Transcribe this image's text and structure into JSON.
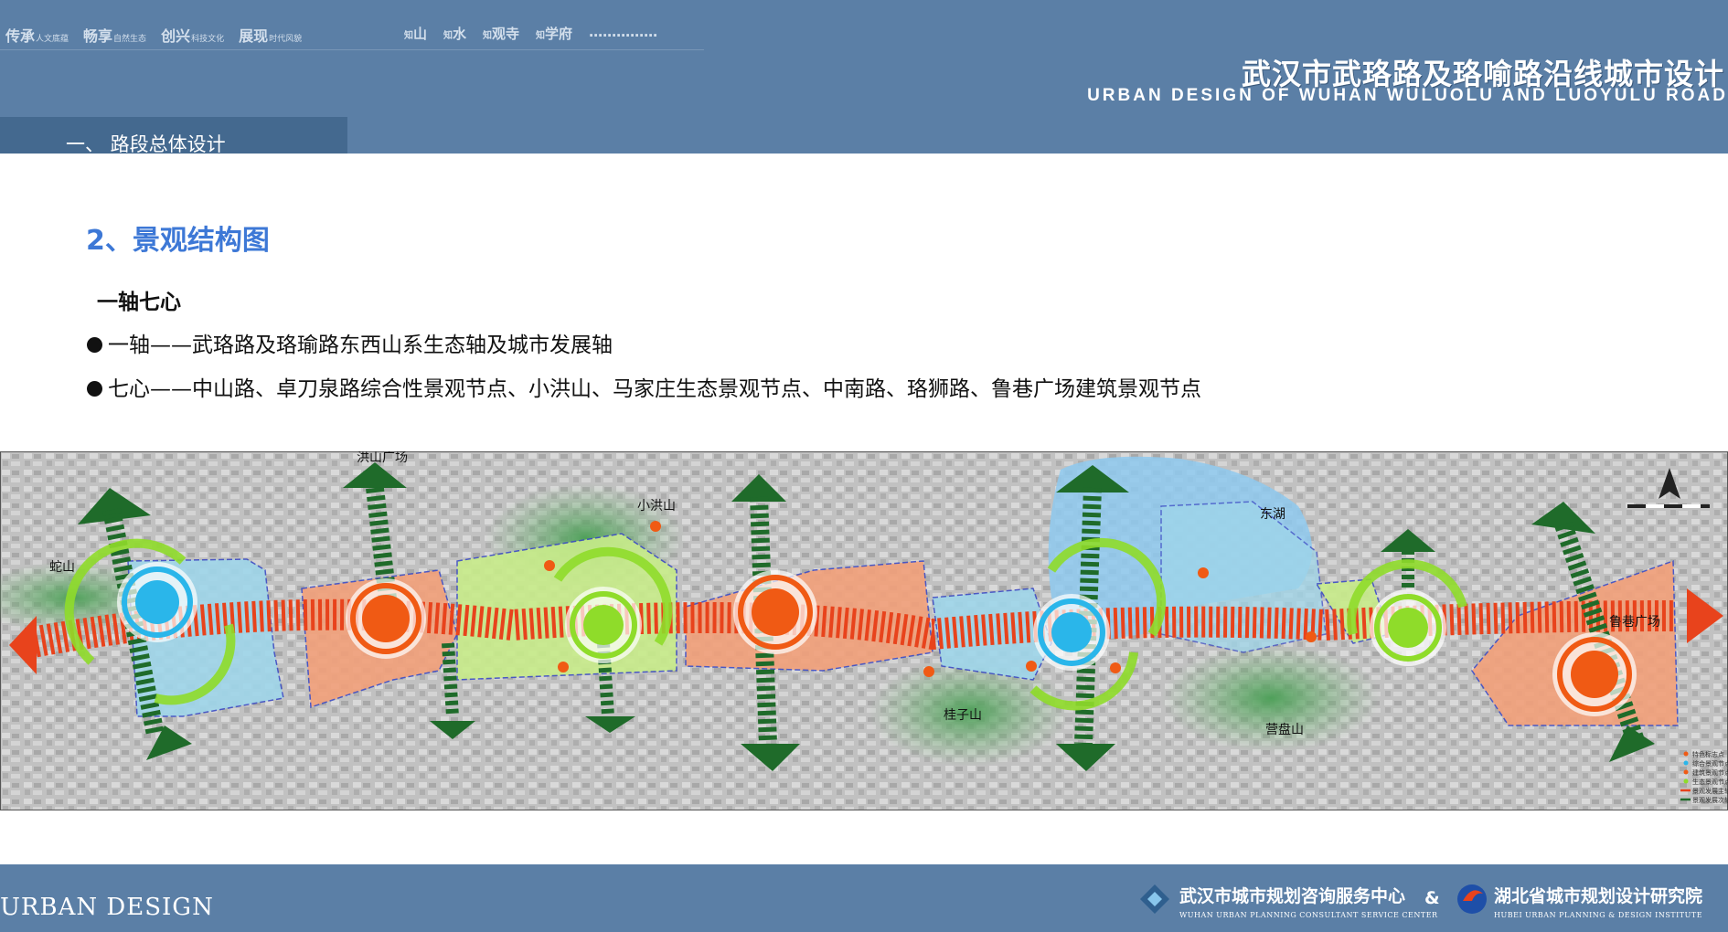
{
  "header": {
    "nav": [
      {
        "main": "传承",
        "sub": "人文底蕴"
      },
      {
        "main": "畅享",
        "sub": "自然生态"
      },
      {
        "main": "创兴",
        "sub": "科技文化"
      },
      {
        "main": "展现",
        "sub": "时代风貌"
      }
    ],
    "nav2": [
      {
        "pre": "知",
        "main": "山"
      },
      {
        "pre": "知",
        "main": "水"
      },
      {
        "pre": "知",
        "main": "观寺"
      },
      {
        "pre": "知",
        "main": "学府"
      },
      {
        "pre": "",
        "main": "……………"
      }
    ],
    "title_cn": "武汉市武珞路及珞喻路沿线城市设计",
    "title_en": "URBAN DESIGN OF WUHAN WULUOLU AND LUOYULU ROAD"
  },
  "section": {
    "label": "一、 路段总体设计"
  },
  "content": {
    "heading": "2、景观结构图",
    "subtitle": "一轴七心",
    "bullets": [
      "一轴——武珞路及珞瑜路东西山系生态轴及城市发展轴",
      "七心——中山路、卓刀泉路综合性景观节点、小洪山、马家庄生态景观节点、中南路、珞狮路、鲁巷广场建筑景观节点"
    ]
  },
  "map": {
    "labels": {
      "she_shan": "蛇山",
      "hongshan_square": "洪山广场",
      "xiao_hongshan": "小洪山",
      "east_lake": "东湖",
      "guizi_shan": "桂子山",
      "yingpan_shan": "营盘山",
      "luxiang_square": "鲁巷广场"
    },
    "legend": [
      "特色标志点",
      "综合景观节点",
      "建筑景观节点",
      "生态景观节点",
      "景观发展主轴",
      "景观发展次轴"
    ],
    "colors": {
      "axis": "#e8431c",
      "orange_node": "#f05a14",
      "blue_node": "#2ab6ea",
      "green_node": "#8fdc2a",
      "arrow_green": "#1f6b2a",
      "orange_zone": "#f2a07a",
      "blue_zone": "#9fd6ea",
      "green_zone": "#c8ec8a"
    }
  },
  "footer": {
    "left": "URBAN   DESIGN",
    "org1_cn": "武汉市城市规划咨询服务中心",
    "org1_en": "WUHAN URBAN PLANNING CONSULTANT SERVICE CENTER",
    "amp": "&",
    "org2_cn": "湖北省城市规划设计研究院",
    "org2_en": "HUBEI URBAN PLANNING & DESIGN INSTITUTE"
  }
}
